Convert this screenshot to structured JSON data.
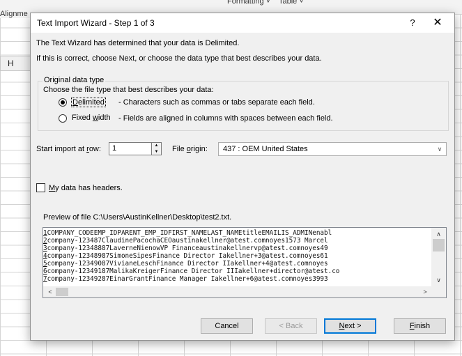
{
  "excel": {
    "ribbon_formatting": "Formatting",
    "ribbon_table": "Table",
    "ribbon_caret": "˅",
    "alignment_label": "Alignme",
    "column_header": "H"
  },
  "dialog": {
    "title": "Text Import Wizard - Step 1 of 3",
    "help_label": "?",
    "close_label": "✕",
    "intro_line1": "The Text Wizard has determined that your data is Delimited.",
    "intro_line2": "If this is correct, choose Next, or choose the data type that best describes your data.",
    "group_label": "Original data type",
    "choose_text": "Choose the file type that best describes your data:",
    "delimited": {
      "label_pre": "",
      "label_key": "D",
      "label_post": "elimited",
      "desc": "- Characters such as commas or tabs separate each field.",
      "selected": true
    },
    "fixed_width": {
      "label_pre": "Fixed ",
      "label_key": "w",
      "label_post": "idth",
      "desc": "- Fields are aligned in columns with spaces between each field.",
      "selected": false
    },
    "start_row": {
      "label_pre": "Start import at ",
      "label_key": "r",
      "label_post": "ow:",
      "value": "1"
    },
    "file_origin": {
      "label_pre": "File ",
      "label_key": "o",
      "label_post": "rigin:",
      "value": "437 : OEM United States"
    },
    "headers_checkbox": {
      "label_key": "M",
      "label_post": "y data has headers.",
      "checked": false
    },
    "preview_label": "Preview of file C:\\Users\\AustinKellner\\Desktop\\test2.txt.",
    "preview_lines": [
      {
        "num": "1",
        "text": "COMPANY_CODEEMP_IDPARENT_EMP_IDFIRST_NAMELAST_NAMEtitleEMAILIS_ADMINenabl"
      },
      {
        "num": "2",
        "text": "company-123487ClaudinePacochaCEOaustinakellner@atest.comnoyes1573 Marcel"
      },
      {
        "num": "3",
        "text": "company-12348887LaverneNienowVP Financeaustinakellnervp@atest.comnoyes49"
      },
      {
        "num": "4",
        "text": "company-12348987SimoneSipesFinance Director Iakellner+3@atest.comnoyes61"
      },
      {
        "num": "5",
        "text": "company-12349087VivianeLeschFinance Director IIakellner+4@atest.comnoyes"
      },
      {
        "num": "6",
        "text": "company-12349187MalikaKreigerFinance Director IIIakellner+director@atest.co"
      },
      {
        "num": "7",
        "text": "company-12349287EinarGrantFinance Manager Iakellner+6@atest.comnoyes3993"
      }
    ],
    "buttons": {
      "cancel": "Cancel",
      "back": "< Back",
      "next_key": "N",
      "next_post": "ext >",
      "finish_key": "F",
      "finish_post": "inish"
    },
    "icons": {
      "spin_up": "▲",
      "spin_down": "▼",
      "combo_arrow": "∨",
      "scroll_up": "∧",
      "scroll_down": "∨",
      "scroll_left": "<",
      "scroll_right": ">"
    }
  }
}
